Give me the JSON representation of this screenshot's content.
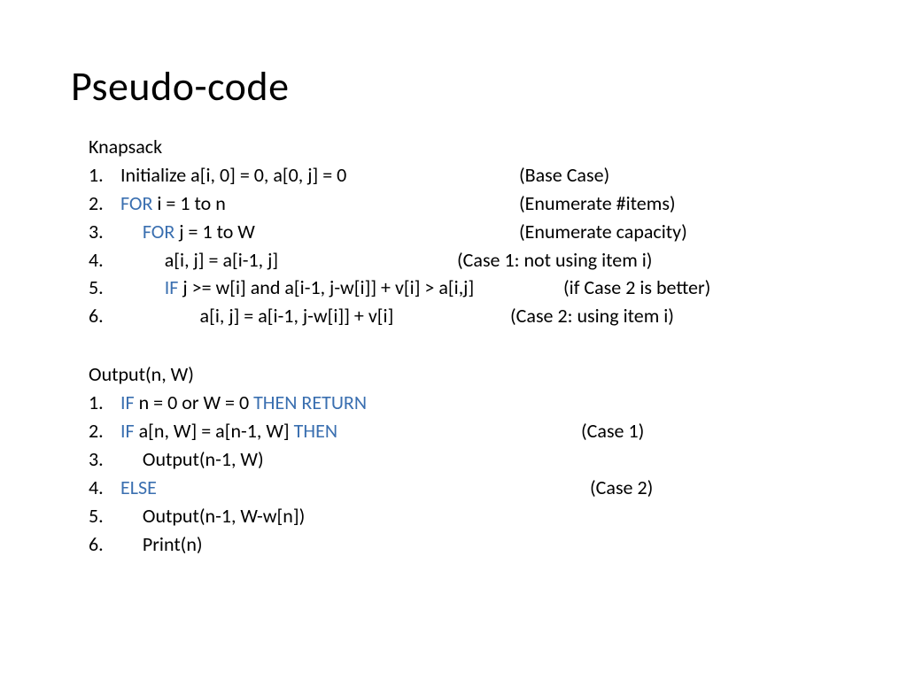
{
  "title": "Pseudo-code",
  "block1": {
    "heading": "Knapsack",
    "lines": [
      {
        "n": "1.",
        "code": "Initialize a[i, 0] = 0, a[0, j] = 0",
        "comment": "(Base Case)"
      },
      {
        "n": "2.",
        "kw1": "FOR",
        "code_after": " i = 1 to n",
        "comment": "(Enumerate #items)"
      },
      {
        "n": "3.",
        "indent": "     ",
        "kw1": "FOR",
        "code_after": " j = 1 to W",
        "comment": "(Enumerate capacity)"
      },
      {
        "n": "4.",
        "indent": "          ",
        "code": "a[i, j] = a[i-1, j]",
        "comment": "(Case 1: not using item i)"
      },
      {
        "n": "5.",
        "indent": "          ",
        "kw1": "IF",
        "code_after": " j >= w[i] and a[i-1, j-w[i]] + v[i] > a[i,j]",
        "comment": "(if Case 2 is better)"
      },
      {
        "n": "6.",
        "indent": "                  ",
        "code": "a[i, j] = a[i-1, j-w[i]] + v[i]",
        "comment": "(Case 2: using item i)"
      }
    ]
  },
  "block2": {
    "heading": "Output(n, W)",
    "lines": [
      {
        "n": "1.",
        "kw1": "IF",
        "mid": " n = 0 or W = 0 ",
        "kw2": "THEN RETURN",
        "comment": ""
      },
      {
        "n": "2.",
        "kw1": "IF",
        "mid": " a[n, W] = a[n-1, W] ",
        "kw2": "THEN",
        "comment": "(Case 1)"
      },
      {
        "n": "3.",
        "indent": "     ",
        "code": "Output(n-1, W)",
        "comment": ""
      },
      {
        "n": "4.",
        "kw1": "ELSE",
        "comment": "(Case 2)"
      },
      {
        "n": "5.",
        "indent": "     ",
        "code": "Output(n-1, W-w[n])",
        "comment": ""
      },
      {
        "n": "6.",
        "indent": "     ",
        "code": "Print(n)",
        "comment": ""
      }
    ]
  }
}
